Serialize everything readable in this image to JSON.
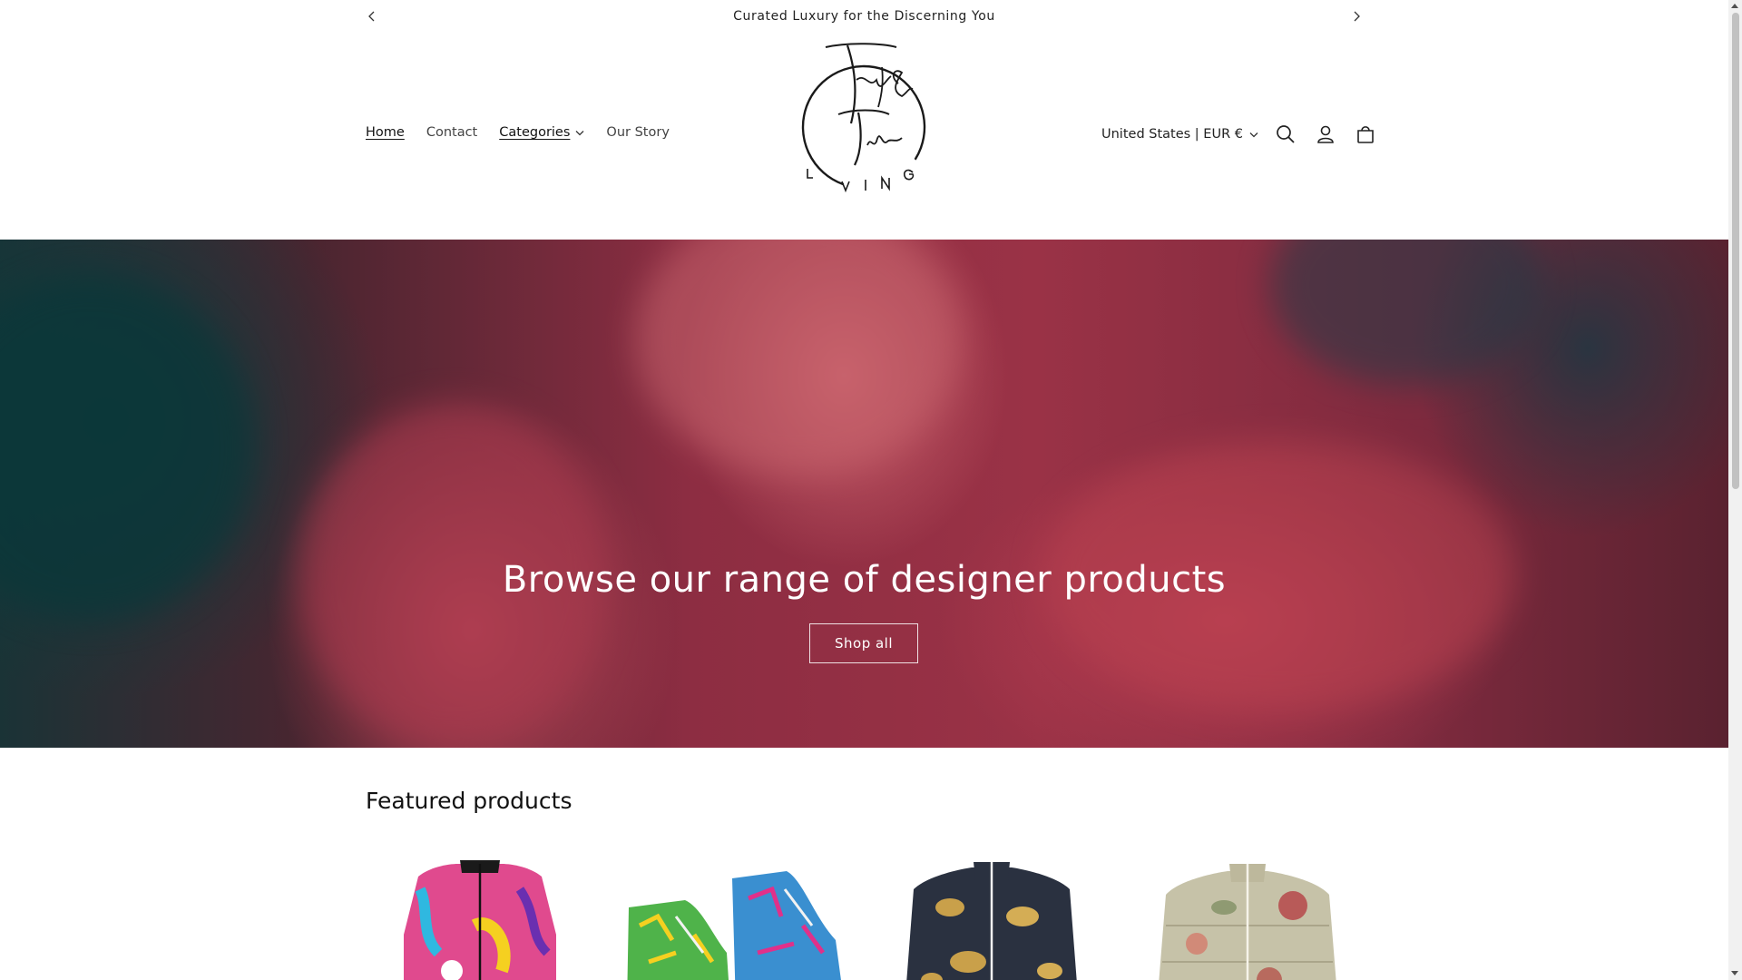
{
  "announcement": {
    "text": "Curated Luxury for the Discerning You"
  },
  "nav": {
    "home": "Home",
    "contact": "Contact",
    "categories": "Categories",
    "our_story": "Our Story"
  },
  "header": {
    "locale": "United States | EUR €"
  },
  "hero": {
    "title": "Browse our range of designer products",
    "button": "Shop all"
  },
  "featured": {
    "title": "Featured products",
    "products": [
      {
        "icon": "bomber-jacket-graffiti-image"
      },
      {
        "icon": "hightop-sneakers-pattern-image"
      },
      {
        "icon": "gold-leopard-jacket-image"
      },
      {
        "icon": "floral-puffer-jacket-image"
      }
    ]
  },
  "colors": {
    "accent": "#121212",
    "hero_red": "#9a3246",
    "hero_teal": "#0e3b3d"
  }
}
